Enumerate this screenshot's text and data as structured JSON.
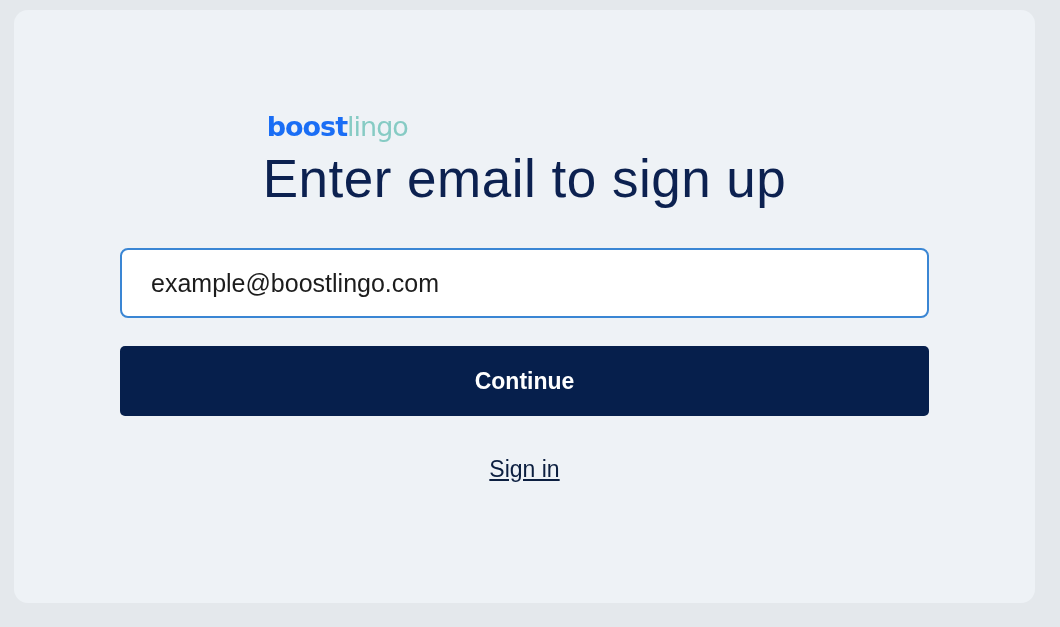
{
  "logo": {
    "parts": [
      {
        "text": "boost",
        "color": "#1a6ef5"
      },
      {
        "text": "lingo",
        "color": "#86cbc4"
      }
    ]
  },
  "heading": "Enter email to sign up",
  "email_field": {
    "value": "example@boostlingo.com",
    "focused": true
  },
  "continue_button": "Continue",
  "sign_in_link": "Sign in"
}
